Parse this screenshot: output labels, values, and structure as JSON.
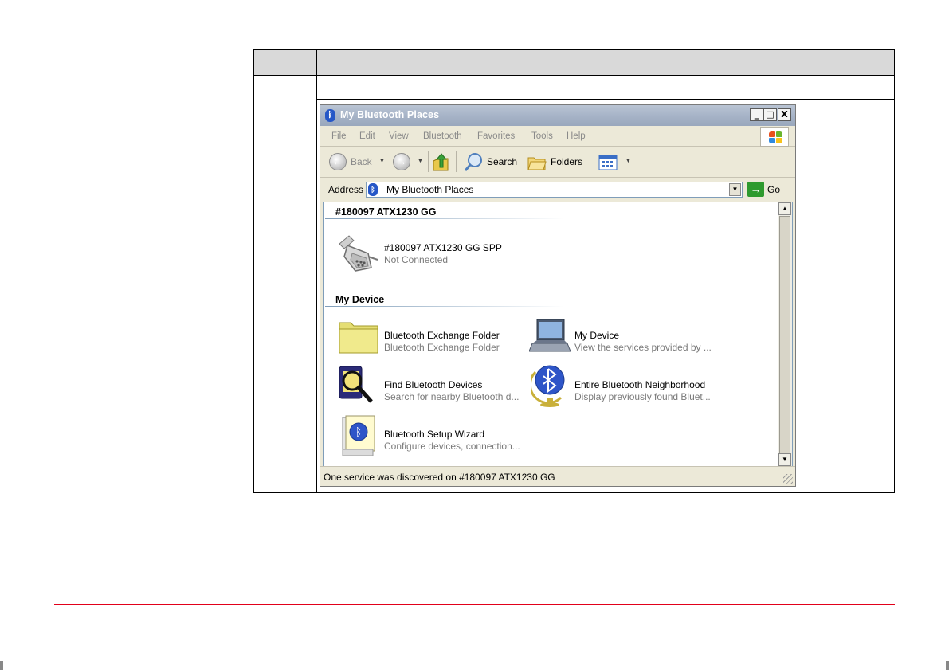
{
  "window": {
    "title": "My Bluetooth Places",
    "caption_buttons": [
      "_",
      "□",
      "X"
    ],
    "menu": [
      "File",
      "Edit",
      "View",
      "Bluetooth",
      "Favorites",
      "Tools",
      "Help"
    ],
    "toolbar": {
      "back": "Back",
      "search": "Search",
      "folders": "Folders"
    },
    "address": {
      "label": "Address",
      "value": "My Bluetooth Places",
      "go": "Go"
    },
    "groups": [
      {
        "title": "#180097 ATX1230 GG",
        "items": [
          {
            "name": "#180097 ATX1230 GG SPP",
            "status": "Not Connected",
            "icon": "serial-port-icon"
          }
        ]
      },
      {
        "title": "My Device",
        "items": [
          {
            "name": "Bluetooth Exchange Folder",
            "status": "Bluetooth Exchange Folder",
            "icon": "folder-icon"
          },
          {
            "name": "My Device",
            "status": "View the services provided by ...",
            "icon": "laptop-icon"
          },
          {
            "name": "Find Bluetooth Devices",
            "status": "Search for nearby Bluetooth d...",
            "icon": "find-devices-icon"
          },
          {
            "name": "Entire Bluetooth Neighborhood",
            "status": "Display previously found Bluet...",
            "icon": "bluetooth-globe-icon"
          },
          {
            "name": "Bluetooth Setup Wizard",
            "status": "Configure devices, connection...",
            "icon": "setup-wizard-icon"
          }
        ]
      }
    ],
    "status_bar": "One service was discovered on #180097 ATX1230 GG"
  },
  "colors": {
    "title_bar": "#a5b2c6",
    "page_rule": "#e2001a",
    "table_header": "#d9d9d9",
    "bluetooth_blue": "#2657c7"
  }
}
